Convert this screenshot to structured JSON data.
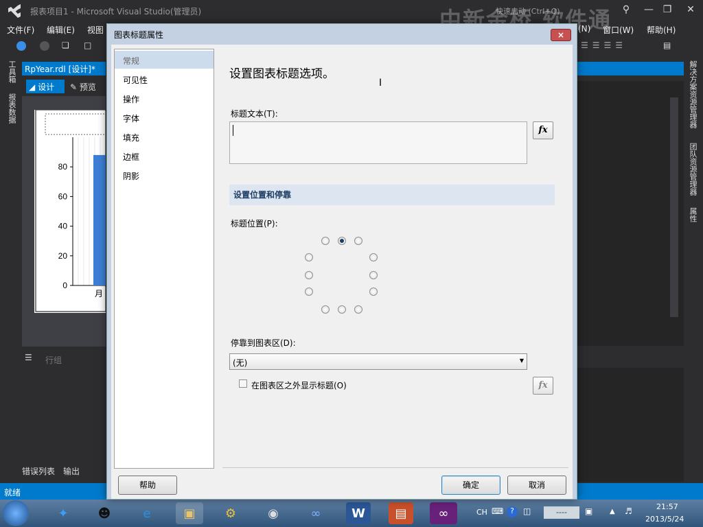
{
  "window": {
    "title": "报表项目1 - Microsoft Visual Studio(管理员)",
    "quick_launch": "快速启动 (Ctrl+Q)",
    "watermark": "中新金桥 软件通"
  },
  "menu": [
    "文件(F)",
    "编辑(E)",
    "视图",
    "(N)",
    "窗口(W)",
    "帮助(H)"
  ],
  "left_strip": {
    "toolbox": "工具箱",
    "report_data": "报表数据"
  },
  "doc_tab": {
    "label": "RpYear.rdl [设计]*",
    "pin": "+"
  },
  "design_bar": {
    "design": "设计",
    "preview": "预览"
  },
  "chart_data": {
    "type": "bar",
    "categories": [
      "月"
    ],
    "values": [
      88
    ],
    "ylim": [
      0,
      100
    ],
    "yticks": [
      "80",
      "60",
      "40",
      "20",
      "0"
    ],
    "xlabel_partial": "月份"
  },
  "row_group": "行组",
  "bottom_tabs": {
    "errors": "错误列表",
    "output": "输出"
  },
  "status": "就绪",
  "right_strip": {
    "solution_explorer": "解决方案资源管理器",
    "team_explorer": "团队资源管理器",
    "properties": "属性"
  },
  "dialog": {
    "title": "图表标题属性",
    "close": "×",
    "nav": [
      "常规",
      "可见性",
      "操作",
      "字体",
      "填充",
      "边框",
      "阴影"
    ],
    "selected_nav": 0,
    "heading": "设置图表标题选项。",
    "title_text_label": "标题文本(T):",
    "title_text_value": "",
    "fx": "fx",
    "section_position": "设置位置和停靠",
    "title_position_label": "标题位置(P):",
    "dock_label": "停靠到图表区(D):",
    "dock_value": "(无)",
    "show_outside_label": "在图表区之外显示标题(O)",
    "show_outside_checked": false,
    "help_button": "帮助",
    "ok_button": "确定",
    "cancel_button": "取消"
  },
  "taskbar": {
    "ime": "CH",
    "clock_time": "21:57",
    "clock_date": "2013/5/24",
    "tray_box": "----"
  },
  "colors": {
    "vs_dark": "#2d2d30",
    "vs_blue": "#007acc",
    "dialog_frame": "#c3d1e2",
    "section_bg": "#dde6f0",
    "bar_blue": "#3e7fd6"
  }
}
